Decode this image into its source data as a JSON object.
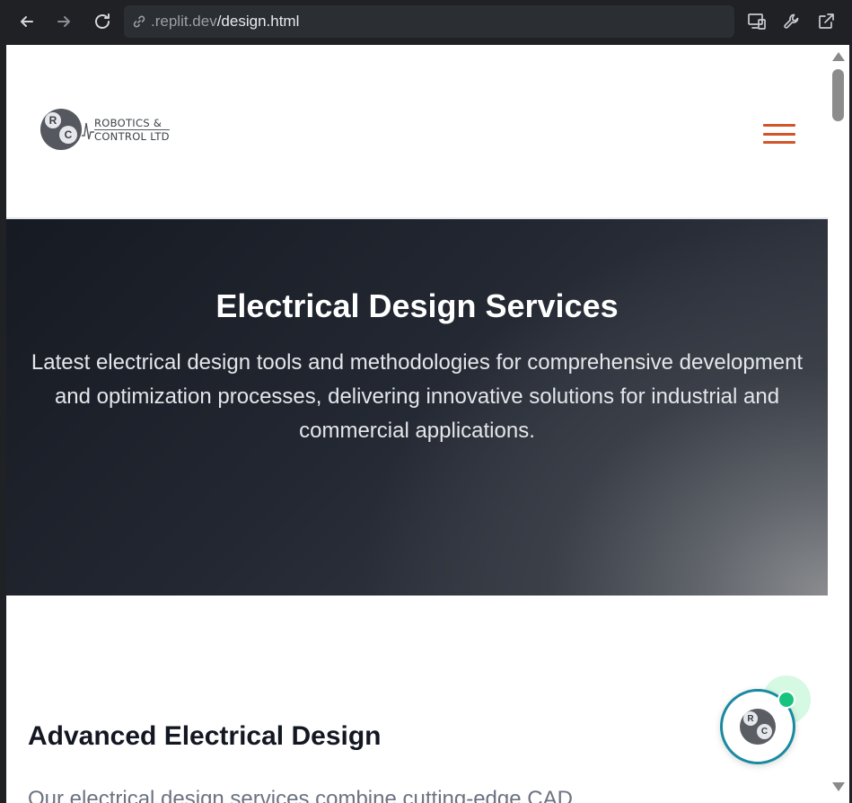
{
  "browser": {
    "url_host": ".replit.dev",
    "url_path": "/design.html"
  },
  "header": {
    "logo_line1": "ROBOTICS &",
    "logo_line2": "CONTROL LTD",
    "logo_mark_r": "R",
    "logo_mark_c": "C",
    "menu_color": "#d2552a"
  },
  "hero": {
    "title": "Electrical Design Services",
    "description": "Latest electrical design tools and methodologies for comprehensive development and optimization processes, delivering innovative solutions for industrial and commercial applications."
  },
  "content": {
    "section_title": "Advanced Electrical Design",
    "section_text": "Our electrical design services combine cutting-edge CAD"
  },
  "chat": {
    "mark_r": "R",
    "mark_c": "C",
    "status_color": "#16c47f",
    "ring_color": "#1a8aa0"
  }
}
